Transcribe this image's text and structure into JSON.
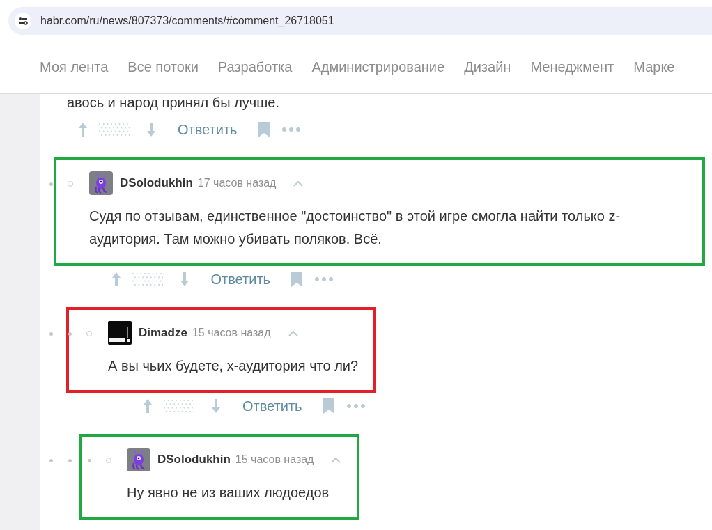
{
  "address_bar": {
    "url": "habr.com/ru/news/807373/comments/#comment_26718051"
  },
  "nav": {
    "items": [
      "Моя лента",
      "Все потоки",
      "Разработка",
      "Администрирование",
      "Дизайн",
      "Менеджмент",
      "Марке"
    ]
  },
  "thread": {
    "text": "авось и народ принял бы лучше.",
    "reply_label": "Ответить",
    "children": [
      {
        "author": "DSolodukhin",
        "kind": "creature",
        "time": "17 часов назад",
        "text": "Судя по отзывам, единственное \"достоинство\" в этой игре смогла найти только z-аудитория. Там можно убивать поляков. Всё.",
        "color": "#22a843",
        "reply_label": "Ответить",
        "children": [
          {
            "author": "Dimadze",
            "kind": "logo",
            "time": "15 часов назад",
            "text": "А вы чьих будете, х-аудитория что ли?",
            "color": "#e2202a",
            "reply_label": "Ответить",
            "children": [
              {
                "author": "DSolodukhin",
                "kind": "creature",
                "time": "15 часов назад",
                "text": "Ну явно не из ваших людоедов",
                "color": "#22a843"
              }
            ]
          }
        ]
      }
    ]
  }
}
